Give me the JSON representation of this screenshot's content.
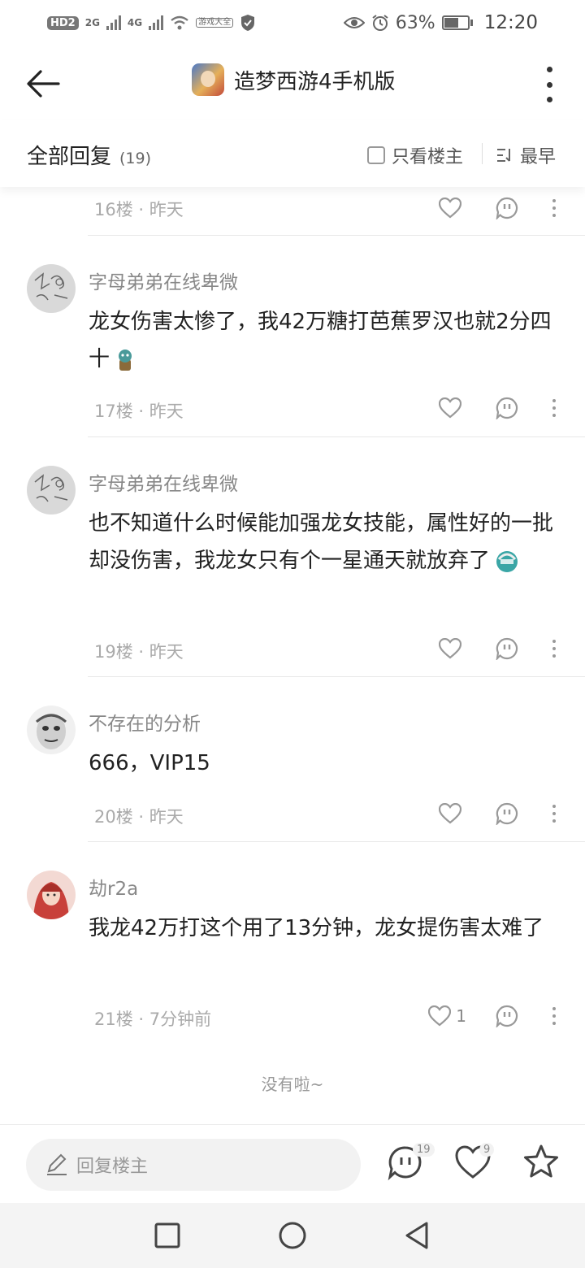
{
  "status_bar": {
    "hd_badge": "HD",
    "hd_sub": "2",
    "net1": "2G",
    "net2": "4G",
    "app_box": "游戏大全",
    "battery_pct": "63%",
    "battery_level": 0.63,
    "time": "12:20"
  },
  "header": {
    "title": "造梦西游4手机版"
  },
  "subheader": {
    "all_replies": "全部回复",
    "count": "(19)",
    "only_owner": "只看楼主",
    "sort": "最早"
  },
  "comments": [
    {
      "username": "",
      "content": "",
      "floor_time": "16楼 · 昨天",
      "likes": ""
    },
    {
      "username": "字母弟弟在线卑微",
      "content": "龙女伤害太惨了，我42万糖打芭蕉罗汉也就2分四十",
      "floor_time": "17楼 · 昨天",
      "likes": ""
    },
    {
      "username": "字母弟弟在线卑微",
      "content": "也不知道什么时候能加强龙女技能，属性好的一批却没伤害，我龙女只有个一星通天就放弃了",
      "floor_time": "19楼 · 昨天",
      "likes": ""
    },
    {
      "username": "不存在的分析",
      "content": "666，VIP15",
      "floor_time": "20楼 · 昨天",
      "likes": ""
    },
    {
      "username": "劫r2a",
      "content": "我龙42万打这个用了13分钟，龙女提伤害太难了",
      "floor_time": "21楼 · 7分钟前",
      "likes": "1"
    }
  ],
  "end_text": "没有啦~",
  "bottom_bar": {
    "reply_placeholder": "回复楼主",
    "comment_badge": "19",
    "like_badge": "9"
  },
  "colors": {
    "text_primary": "#222222",
    "text_secondary": "#888888",
    "text_meta": "#aaaaaa",
    "icon": "#999999"
  }
}
